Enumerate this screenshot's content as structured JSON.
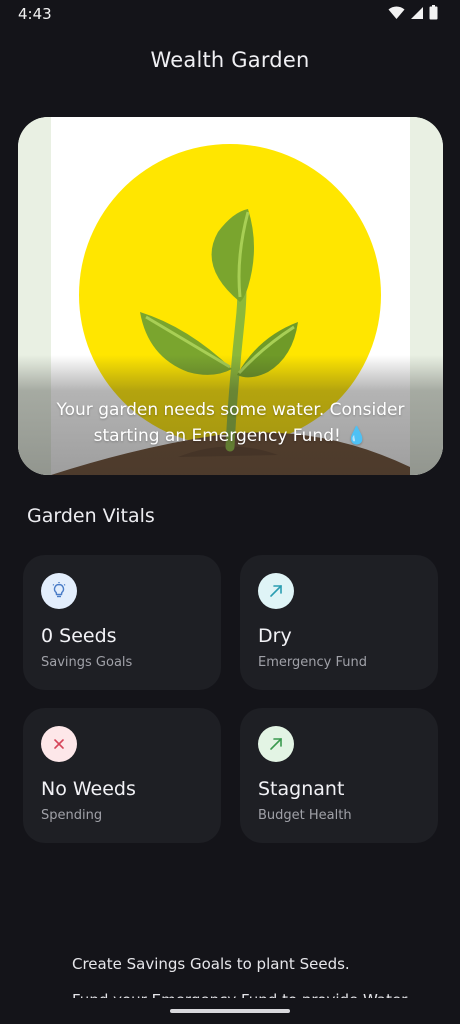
{
  "status_bar": {
    "time": "4:43"
  },
  "app": {
    "title": "Wealth Garden"
  },
  "hero": {
    "message": "Your garden needs some water. Consider starting an Emergency Fund! 💧",
    "colors": {
      "sun": "#ffe600",
      "leaf": "#7aa52e",
      "soil": "#6b4a2f"
    }
  },
  "vitals": {
    "title": "Garden Vitals",
    "cards": [
      {
        "value": "0 Seeds",
        "label": "Savings Goals",
        "icon": "lightbulb-icon",
        "icon_bg": "#e3eefc",
        "icon_color": "#4a7cc7"
      },
      {
        "value": "Dry",
        "label": "Emergency Fund",
        "icon": "trending-up-icon",
        "icon_bg": "#dff4f6",
        "icon_color": "#2a9db1"
      },
      {
        "value": "No Weeds",
        "label": "Spending",
        "icon": "close-icon",
        "icon_bg": "#fde7e9",
        "icon_color": "#d6455a"
      },
      {
        "value": "Stagnant",
        "label": "Budget Health",
        "icon": "trending-up-icon",
        "icon_bg": "#e3f4e4",
        "icon_color": "#3a9a4e"
      }
    ]
  },
  "tips": [
    "Create Savings Goals to plant Seeds.",
    "Fund your Emergency Fund to provide Water."
  ]
}
